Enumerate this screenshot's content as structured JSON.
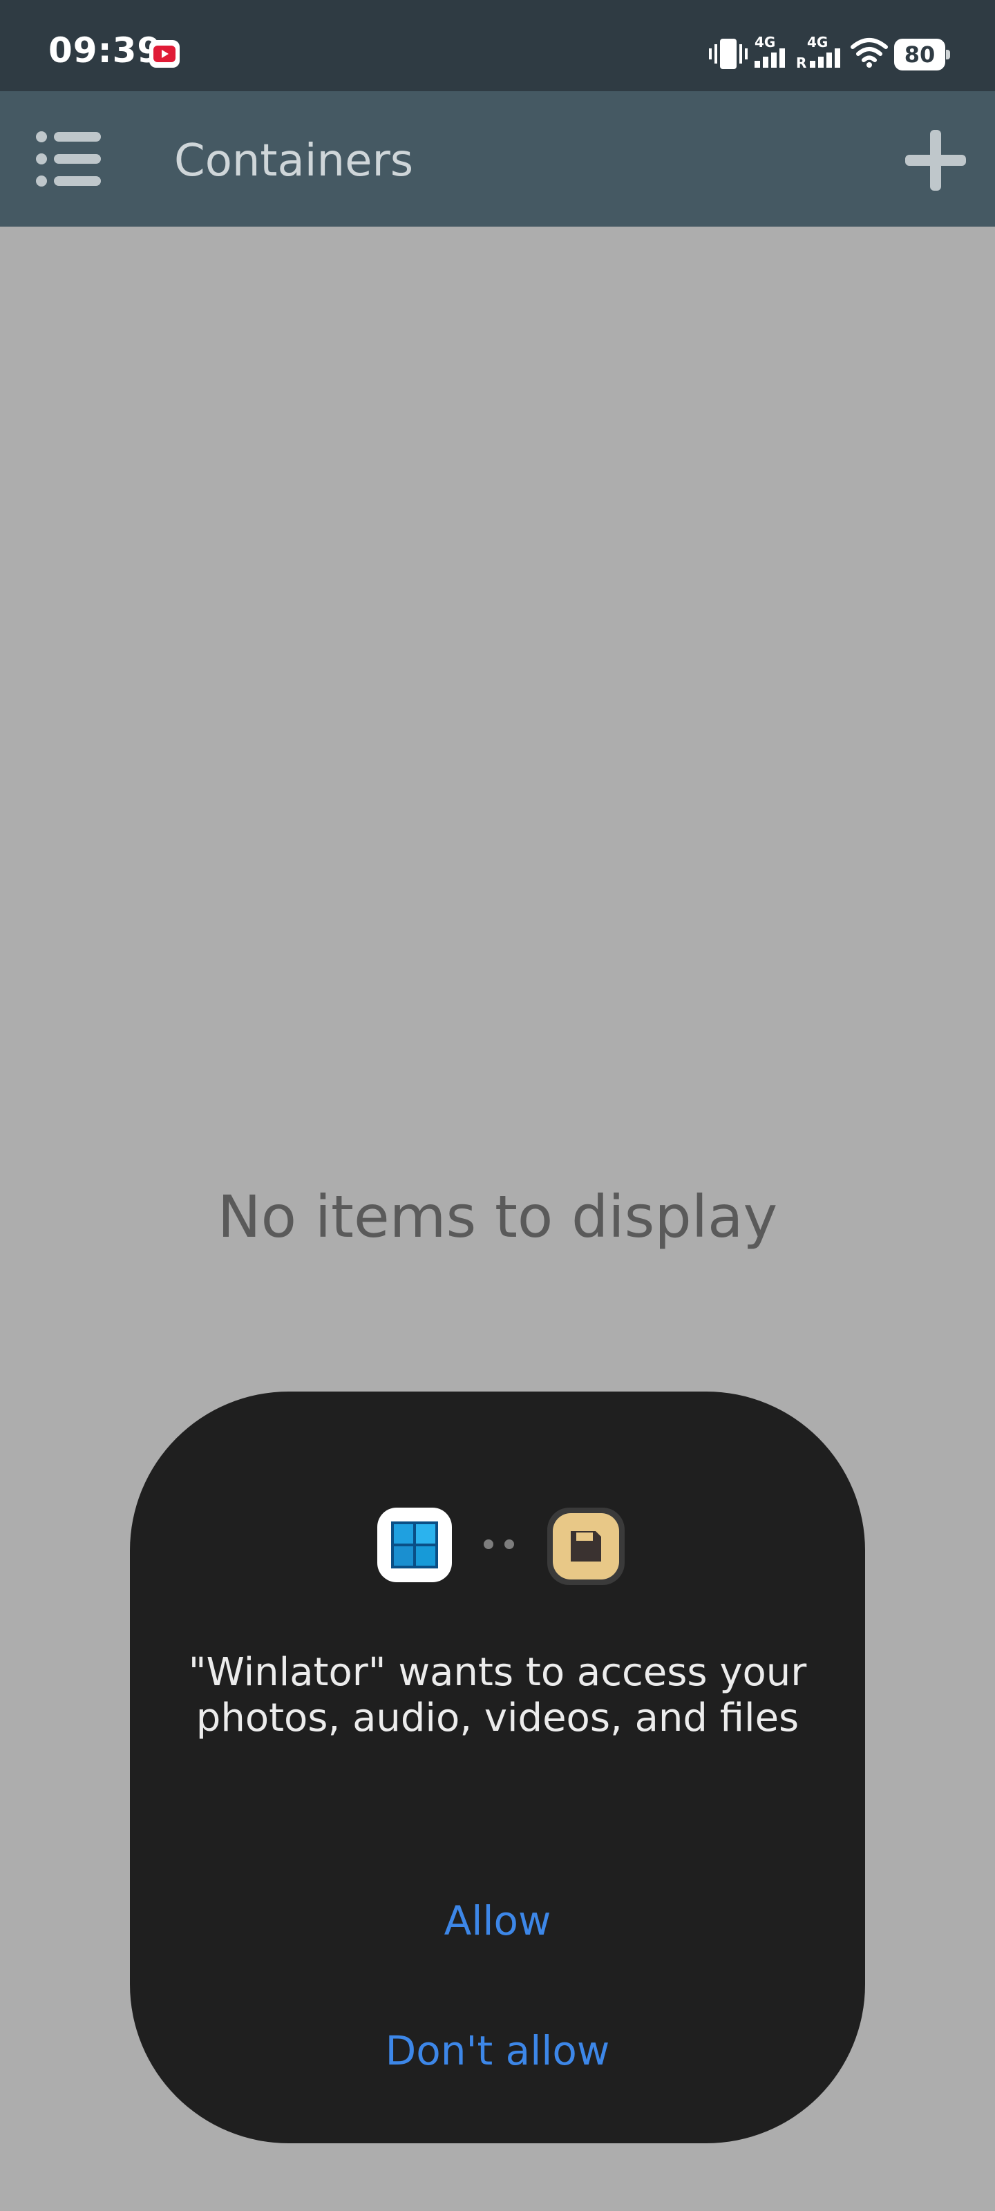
{
  "status_bar": {
    "time": "09:39",
    "battery_level": "80",
    "network_labels": [
      "4G",
      "4G",
      "R"
    ],
    "icons": [
      "youtube-notification-icon",
      "vibrate-icon",
      "signal-icon",
      "roaming-signal-icon",
      "wifi-icon",
      "battery-icon"
    ]
  },
  "app_bar": {
    "title": "Containers",
    "icons": [
      "menu-icon",
      "add-icon"
    ]
  },
  "empty_state": {
    "text": "No items to display"
  },
  "dialog": {
    "message": "\"Winlator\" wants to access your photos, audio, videos, and files",
    "allow_label": "Allow",
    "deny_label": "Don't allow",
    "icons": [
      "winlator-app-icon",
      "storage-permission-icon"
    ]
  },
  "colors": {
    "status_bar_bg": "#2f3b43",
    "app_bar_bg": "#455963",
    "screen_bg": "#adadad",
    "dialog_bg": "#1f1f1f",
    "button_text": "#3d87e8",
    "permission_icon_bg": "#e8c887"
  }
}
